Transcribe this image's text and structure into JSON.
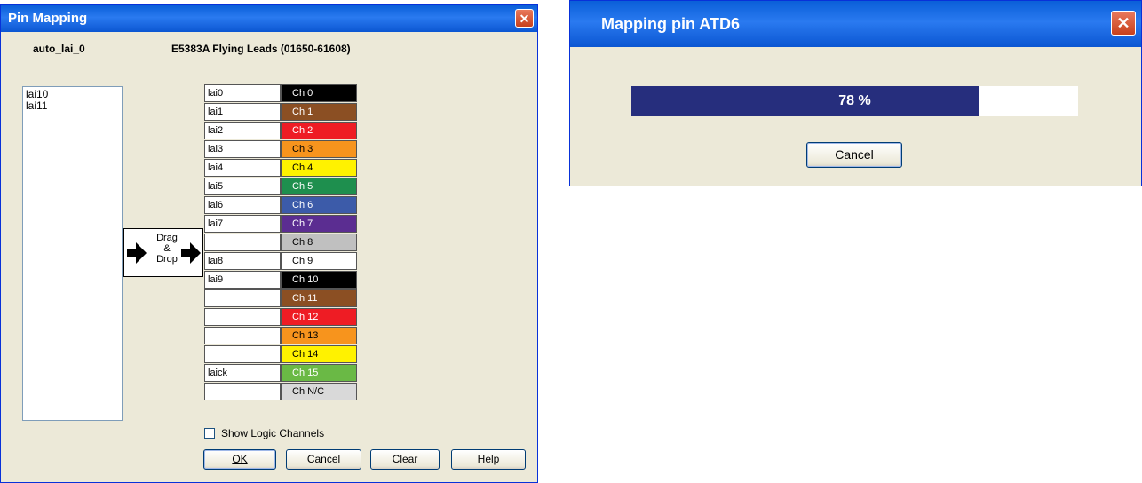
{
  "pin_mapping": {
    "title": "Pin Mapping",
    "module_name": "auto_lai_0",
    "cable_name": "E5383A Flying Leads (01650-61608)",
    "unassigned_pins": [
      "lai10",
      "lai11"
    ],
    "drag_label": [
      "Drag",
      "&",
      "Drop"
    ],
    "rows": [
      {
        "pin": "lai0",
        "channel": "Ch 0",
        "color": "#000000",
        "text_color": "#ffffff"
      },
      {
        "pin": "lai1",
        "channel": "Ch 1",
        "color": "#8b4f23",
        "text_color": "#ffffff"
      },
      {
        "pin": "lai2",
        "channel": "Ch 2",
        "color": "#ee1c24",
        "text_color": "#ffffff"
      },
      {
        "pin": "lai3",
        "channel": "Ch 3",
        "color": "#f7941d",
        "text_color": "#000000"
      },
      {
        "pin": "lai4",
        "channel": "Ch 4",
        "color": "#fff200",
        "text_color": "#000000"
      },
      {
        "pin": "lai5",
        "channel": "Ch 5",
        "color": "#1e8f4e",
        "text_color": "#ffffff"
      },
      {
        "pin": "lai6",
        "channel": "Ch 6",
        "color": "#3c5ba9",
        "text_color": "#ffffff"
      },
      {
        "pin": "lai7",
        "channel": "Ch 7",
        "color": "#5b2d91",
        "text_color": "#ffffff"
      },
      {
        "pin": "",
        "channel": "Ch 8",
        "color": "#c0c0c0",
        "text_color": "#000000"
      },
      {
        "pin": "lai8",
        "channel": "Ch 9",
        "color": "#ffffff",
        "text_color": "#000000"
      },
      {
        "pin": "lai9",
        "channel": "Ch 10",
        "color": "#000000",
        "text_color": "#ffffff"
      },
      {
        "pin": "",
        "channel": "Ch 11",
        "color": "#8b4f23",
        "text_color": "#ffffff"
      },
      {
        "pin": "",
        "channel": "Ch 12",
        "color": "#ee1c24",
        "text_color": "#ffffff"
      },
      {
        "pin": "",
        "channel": "Ch 13",
        "color": "#f7941d",
        "text_color": "#000000"
      },
      {
        "pin": "",
        "channel": "Ch 14",
        "color": "#fff200",
        "text_color": "#000000"
      },
      {
        "pin": "laick",
        "channel": "Ch 15",
        "color": "#6ab945",
        "text_color": "#ffffff"
      },
      {
        "pin": "",
        "channel": "Ch N/C",
        "color": "#d9d9d9",
        "text_color": "#000000"
      }
    ],
    "show_logic_channels_label": "Show Logic Channels",
    "show_logic_channels_checked": false,
    "buttons": {
      "ok": {
        "label": "OK",
        "mnemonic": "O"
      },
      "cancel": {
        "label": "Cancel",
        "mnemonic": ""
      },
      "clear": {
        "label": "Clear",
        "mnemonic": "l"
      },
      "help": {
        "label": "Help",
        "mnemonic": "H"
      }
    },
    "close_glyph": "✕"
  },
  "progress_dialog": {
    "title": "Mapping pin ATD6",
    "progress_percent": 78,
    "progress_text": "78 %",
    "cancel_label": "Cancel",
    "close_glyph": "✕"
  },
  "colors": {
    "titlebar": "#0a5fd8",
    "dialog_bg": "#ece9d8",
    "progress_fill": "#262e7d"
  }
}
